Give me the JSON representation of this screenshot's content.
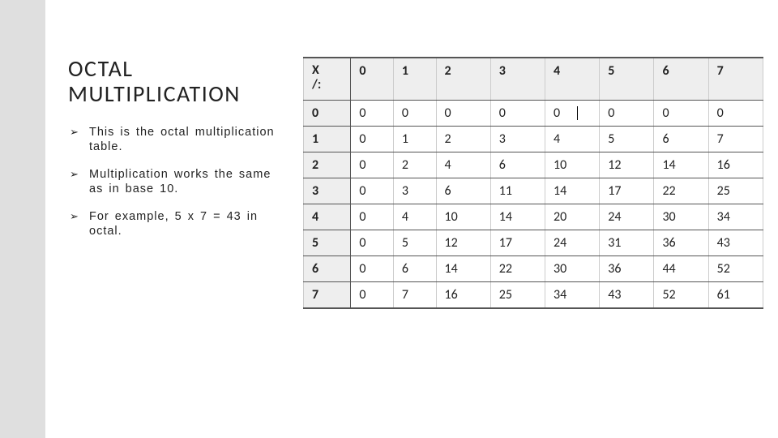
{
  "heading_line1": "OCTAL",
  "heading_line2": "MULTIPLICATION",
  "bullets": [
    "This is the octal multiplication table.",
    "Multiplication works the same as in base 10.",
    "For example, 5 x 7 = 43 in octal."
  ],
  "table": {
    "corner": "X\n/:",
    "col_headers": [
      "0",
      "1",
      "2",
      "3",
      "4",
      "5",
      "6",
      "7"
    ],
    "rows": [
      {
        "h": "0",
        "cells": [
          "0",
          "0",
          "0",
          "0",
          "0",
          "0",
          "0",
          "0"
        ]
      },
      {
        "h": "1",
        "cells": [
          "0",
          "1",
          "2",
          "3",
          "4",
          "5",
          "6",
          "7"
        ]
      },
      {
        "h": "2",
        "cells": [
          "0",
          "2",
          "4",
          "6",
          "10",
          "12",
          "14",
          "16"
        ]
      },
      {
        "h": "3",
        "cells": [
          "0",
          "3",
          "6",
          "11",
          "14",
          "17",
          "22",
          "25"
        ]
      },
      {
        "h": "4",
        "cells": [
          "0",
          "4",
          "10",
          "14",
          "20",
          "24",
          "30",
          "34"
        ]
      },
      {
        "h": "5",
        "cells": [
          "0",
          "5",
          "12",
          "17",
          "24",
          "31",
          "36",
          "43"
        ]
      },
      {
        "h": "6",
        "cells": [
          "0",
          "6",
          "14",
          "22",
          "30",
          "36",
          "44",
          "52"
        ]
      },
      {
        "h": "7",
        "cells": [
          "0",
          "7",
          "16",
          "25",
          "34",
          "43",
          "52",
          "61"
        ]
      }
    ]
  },
  "chart_data": {
    "type": "table",
    "title": "Octal multiplication table",
    "col_headers": [
      "0",
      "1",
      "2",
      "3",
      "4",
      "5",
      "6",
      "7"
    ],
    "row_headers": [
      "0",
      "1",
      "2",
      "3",
      "4",
      "5",
      "6",
      "7"
    ],
    "cells": [
      [
        "0",
        "0",
        "0",
        "0",
        "0",
        "0",
        "0",
        "0"
      ],
      [
        "0",
        "1",
        "2",
        "3",
        "4",
        "5",
        "6",
        "7"
      ],
      [
        "0",
        "2",
        "4",
        "6",
        "10",
        "12",
        "14",
        "16"
      ],
      [
        "0",
        "3",
        "6",
        "11",
        "14",
        "17",
        "22",
        "25"
      ],
      [
        "0",
        "4",
        "10",
        "14",
        "20",
        "24",
        "30",
        "34"
      ],
      [
        "0",
        "5",
        "12",
        "17",
        "24",
        "31",
        "36",
        "43"
      ],
      [
        "0",
        "6",
        "14",
        "22",
        "30",
        "36",
        "44",
        "52"
      ],
      [
        "0",
        "7",
        "16",
        "25",
        "34",
        "43",
        "52",
        "61"
      ]
    ]
  }
}
